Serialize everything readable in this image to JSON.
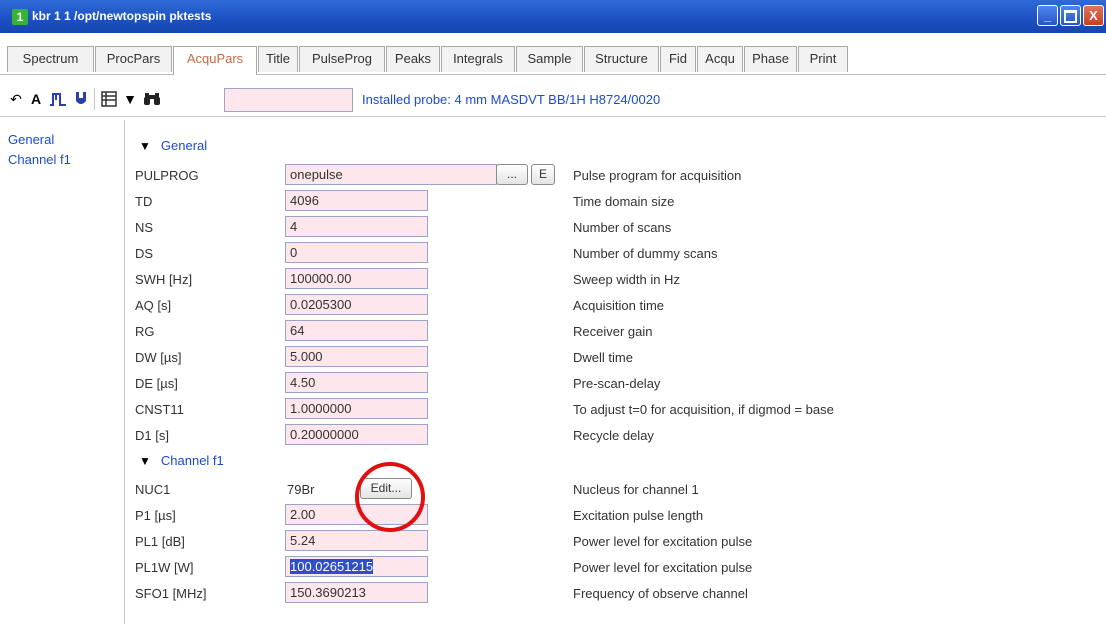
{
  "window": {
    "number": "1",
    "title": "kbr  1  1  /opt/newtopspin  pktests",
    "minimize": "_",
    "close": "X"
  },
  "tabs": [
    {
      "label": "Spectrum"
    },
    {
      "label": "ProcPars"
    },
    {
      "label": "AcquPars",
      "active": true
    },
    {
      "label": "Title"
    },
    {
      "label": "PulseProg"
    },
    {
      "label": "Peaks"
    },
    {
      "label": "Integrals"
    },
    {
      "label": "Sample"
    },
    {
      "label": "Structure"
    },
    {
      "label": "Fid"
    },
    {
      "label": "Acqu"
    },
    {
      "label": "Phase"
    },
    {
      "label": "Print"
    }
  ],
  "toolbar": {
    "icons": [
      "undo-icon",
      "text-a-icon",
      "pulse-icon",
      "probe-icon",
      "table-icon",
      "filter-icon",
      "binoculars-icon"
    ],
    "search_value": "",
    "probe_text": "Installed probe: 4 mm MASDVT BB/1H H8724/0020"
  },
  "nav": {
    "items": [
      "General",
      "Channel f1"
    ]
  },
  "sections": {
    "general": "General",
    "channel": "Channel f1"
  },
  "params": {
    "pulprog": {
      "name": "PULPROG",
      "value": "onepulse",
      "desc": "Pulse program for acquisition",
      "dots_label": "...",
      "e_label": "E"
    },
    "td": {
      "name": "TD",
      "value": "4096",
      "desc": "Time domain size"
    },
    "ns": {
      "name": "NS",
      "value": "4",
      "desc": "Number of scans"
    },
    "ds": {
      "name": "DS",
      "value": "0",
      "desc": "Number of dummy scans"
    },
    "swh": {
      "name": "SWH [Hz]",
      "value": "100000.00",
      "desc": "Sweep width in Hz"
    },
    "aq": {
      "name": "AQ [s]",
      "value": "0.0205300",
      "desc": "Acquisition time"
    },
    "rg": {
      "name": "RG",
      "value": "64",
      "desc": "Receiver gain"
    },
    "dw": {
      "name": "DW [µs]",
      "value": "5.000",
      "desc": "Dwell time"
    },
    "de": {
      "name": "DE [µs]",
      "value": "4.50",
      "desc": "Pre-scan-delay"
    },
    "cnst11": {
      "name": "CNST11",
      "value": "1.0000000",
      "desc": "To adjust t=0 for acquisition, if digmod = base"
    },
    "d1": {
      "name": "D1 [s]",
      "value": "0.20000000",
      "desc": "Recycle delay"
    },
    "nuc1": {
      "name": "NUC1",
      "value": "79Br",
      "edit_label": "Edit...",
      "desc": "Nucleus for channel 1"
    },
    "p1": {
      "name": "P1 [µs]",
      "value": "2.00",
      "desc": "Excitation pulse length"
    },
    "pl1": {
      "name": "PL1 [dB]",
      "value": "5.24",
      "desc": "Power level for excitation pulse"
    },
    "pl1w": {
      "name": "PL1W [W]",
      "value": "100.02651215",
      "desc": "Power level for excitation pulse"
    },
    "sfo1": {
      "name": "SFO1 [MHz]",
      "value": "150.3690213",
      "desc": "Frequency of observe channel"
    }
  },
  "colors": {
    "title_bar": "#1c50c2",
    "field_bg": "#fde6ec",
    "link_blue": "#1c4bd0",
    "active_tab": "#c86a44",
    "highlight_circle": "#e01010"
  }
}
